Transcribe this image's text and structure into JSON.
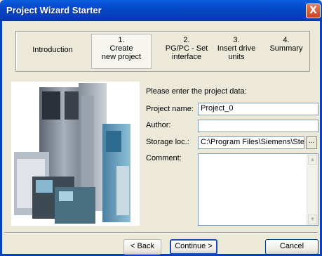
{
  "window": {
    "title": "Project Wizard Starter",
    "close_symbol": "X"
  },
  "steps": [
    {
      "number": "",
      "label": "Introduction"
    },
    {
      "number": "1.",
      "label": "Create\nnew project"
    },
    {
      "number": "2.",
      "label": "PG/PC - Set\ninterface"
    },
    {
      "number": "3.",
      "label": "Insert drive\nunits"
    },
    {
      "number": "4.",
      "label": "Summary"
    }
  ],
  "active_step": 1,
  "form": {
    "heading": "Please enter the project data:",
    "project_name_label": "Project name:",
    "project_name_value": "Project_0",
    "author_label": "Author:",
    "author_value": "",
    "storage_label": "Storage loc.:",
    "storage_value": "C:\\Program Files\\Siemens\\Ste",
    "browse_label": "...",
    "comment_label": "Comment:",
    "comment_value": ""
  },
  "buttons": {
    "back": "< Back",
    "continue": "Continue >",
    "cancel": "Cancel"
  },
  "colors": {
    "titlebar": "#0548c8",
    "frame": "#0841c0",
    "dialog_bg": "#ece9d8",
    "close_button": "#d0411e"
  }
}
